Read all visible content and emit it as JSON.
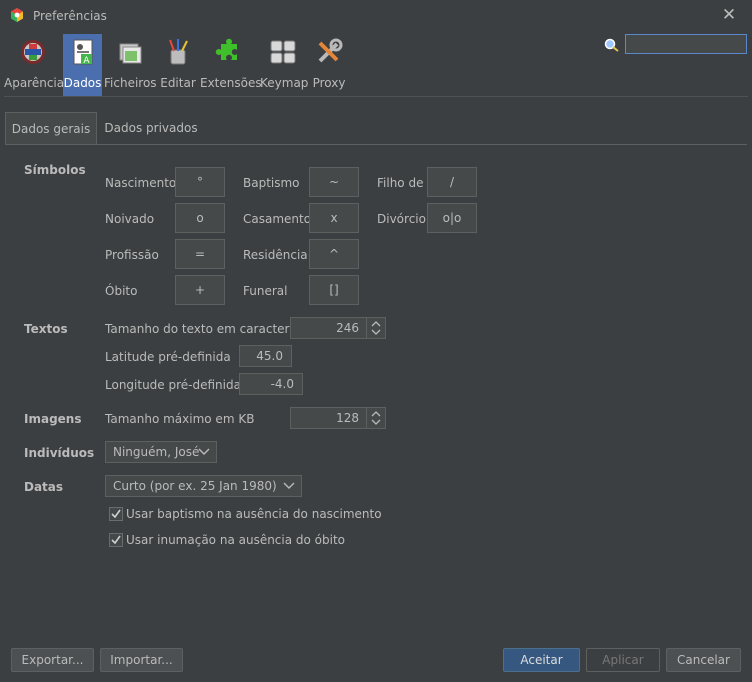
{
  "window": {
    "title": "Preferências",
    "close_icon": "close-icon"
  },
  "toolbar": {
    "items": [
      {
        "label": "Aparência",
        "icon": "appearance-icon"
      },
      {
        "label": "Dados",
        "icon": "data-icon",
        "selected": true
      },
      {
        "label": "Ficheiros",
        "icon": "folders-icon"
      },
      {
        "label": "Editar",
        "icon": "edit-icon"
      },
      {
        "label": "Extensões",
        "icon": "puzzle-icon"
      },
      {
        "label": "Keymap",
        "icon": "keyboard-icon"
      },
      {
        "label": "Proxy",
        "icon": "tools-icon"
      }
    ],
    "search_value": ""
  },
  "tabs": [
    {
      "label": "Dados gerais",
      "selected": true
    },
    {
      "label": "Dados privados"
    }
  ],
  "symbols": {
    "section": "Símbolos",
    "items": [
      {
        "label": "Nascimento",
        "value": "°"
      },
      {
        "label": "Baptismo",
        "value": "~"
      },
      {
        "label": "Filho de",
        "value": "/"
      },
      {
        "label": "Noivado",
        "value": "o"
      },
      {
        "label": "Casamento",
        "value": "x"
      },
      {
        "label": "Divórcio",
        "value": "o|o"
      },
      {
        "label": "Profissão",
        "value": "="
      },
      {
        "label": "Residência",
        "value": "^"
      },
      {
        "label": "Óbito",
        "value": "+"
      },
      {
        "label": "Funeral",
        "value": "[]"
      }
    ]
  },
  "texts": {
    "section": "Textos",
    "text_size_label": "Tamanho do texto em caracteres",
    "text_size": "246",
    "latitude_label": "Latitude pré-definida",
    "latitude": "45.0",
    "longitude_label": "Longitude pré-definida",
    "longitude": "-4.0"
  },
  "images": {
    "section": "Imagens",
    "max_size_label": "Tamanho máximo em KB",
    "max_size": "128"
  },
  "individuals": {
    "section": "Indivíduos",
    "selected": "Ninguém, José"
  },
  "dates": {
    "section": "Datas",
    "format": "Curto (por ex. 25 Jan 1980)",
    "baptism_checkbox": "Usar baptismo na ausência do nascimento",
    "baptism_checked": true,
    "burial_checkbox": "Usar inumação na ausência do óbito",
    "burial_checked": true
  },
  "buttons": {
    "export": "Exportar...",
    "import": "Importar...",
    "accept": "Aceitar",
    "apply": "Aplicar",
    "cancel": "Cancelar"
  }
}
